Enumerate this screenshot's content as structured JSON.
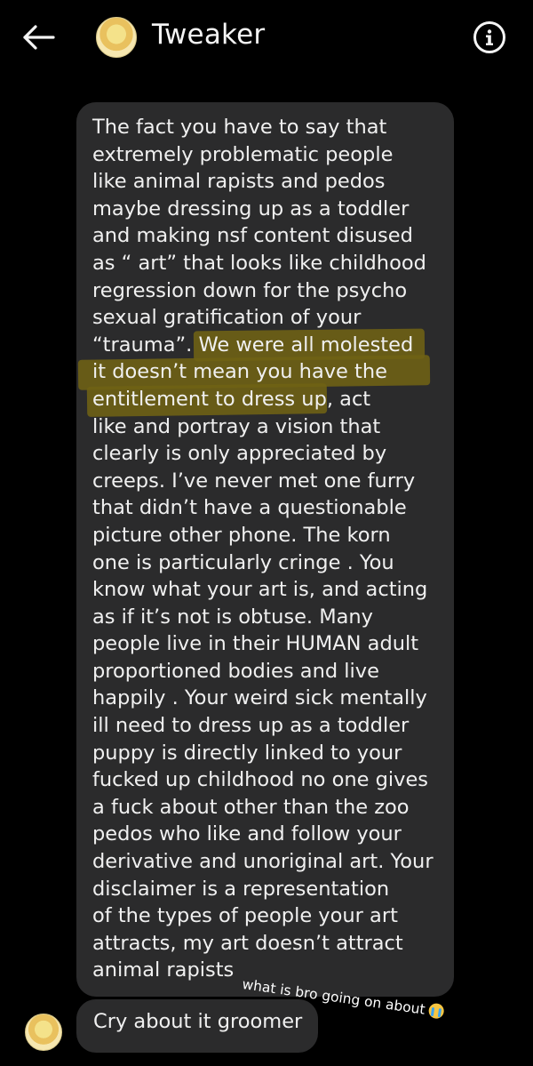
{
  "header": {
    "back_icon": "arrow-left-icon",
    "contact_name": "Tweaker",
    "info_icon": "info-icon"
  },
  "messages": [
    {
      "text": "The fact you have to say that\nextremely problematic people\nlike animal rapists and pedos\nmaybe dressing up as a toddler\nand making nsf content disused\nas “ art” that looks like childhood\nregression down for the psycho\nsexual gratification of your\n“trauma”. We were all molested\nit doesn’t mean you have the\nentitlement to dress up, act\nlike and portray a vision that\nclearly is only appreciated by\ncreeps. I’ve never met one furry\nthat didn’t have a questionable\npicture other phone. The korn\none is particularly cringe . You\nknow what your art is, and acting\nas if it’s not is obtuse. Many\npeople live in their HUMAN adult\nproportioned bodies and live\nhappily . Your weird sick mentally\nill need to dress up as a toddler\npuppy is directly linked to your\nfucked up childhood no one gives\na fuck about other than the zoo\npedos who like and follow your\nderivative and unoriginal art. Your\ndisclaimer is a representation\nof the types of people your art\nattracts, my art doesn’t attract\nanimal rapists"
    },
    {
      "text": "Cry about it groomer"
    }
  ],
  "annotation": {
    "text": "what is bro going on about",
    "emoji": "loudly-crying-face-icon"
  },
  "colors": {
    "background": "#000000",
    "bubble": "#2b2b2c",
    "highlight": "#6f6214",
    "text": "#f0f0f0"
  }
}
